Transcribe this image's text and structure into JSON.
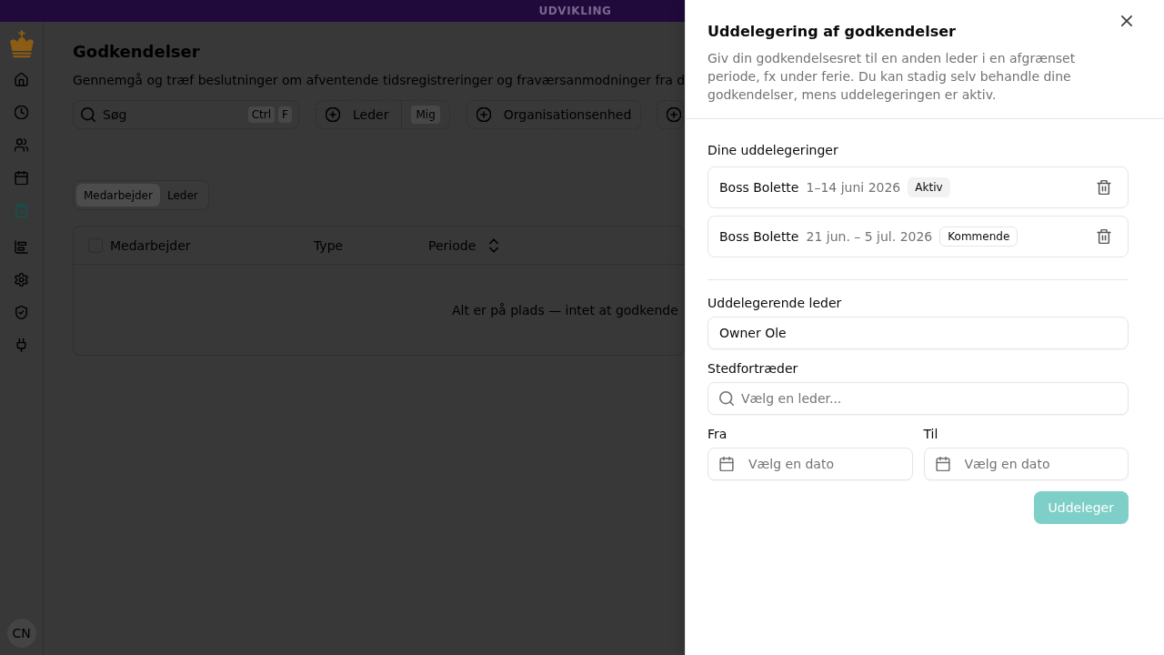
{
  "dev_banner": {
    "label": "UDVIKLING"
  },
  "sidebar": {
    "sections": [
      {
        "items": [
          {
            "selected": false
          },
          {
            "selected": false
          },
          {
            "selected": false
          },
          {
            "selected": false
          },
          {
            "selected": true
          }
        ]
      },
      {
        "items": [
          {
            "selected": false
          },
          {
            "selected": false
          },
          {
            "selected": false
          },
          {
            "selected": false
          }
        ]
      }
    ],
    "user": {
      "initials": "CN"
    }
  },
  "page": {
    "title": "Godkendelser",
    "description": "Gennemgå og træf beslutninger om afventende tidsregistreringer og fraværsanmodninger fra d"
  },
  "filters": {
    "search": {
      "placeholder": "Søg",
      "shortcut": [
        "Ctrl",
        "F"
      ]
    },
    "buttons": [
      {
        "kind": "filter",
        "label": "Leder",
        "value": "Mig"
      },
      {
        "kind": "filter",
        "label": "Organisationsenhed"
      },
      {
        "kind": "filter"
      }
    ]
  },
  "role_tabs": [
    {
      "label": "Medarbejder",
      "selected": true
    },
    {
      "label": "Leder",
      "selected": false
    }
  ],
  "table": {
    "select_all": {
      "checked": false
    },
    "columns": [
      {
        "label": "Medarbejder",
        "sortable": false
      },
      {
        "label": "Type",
        "sortable": false
      },
      {
        "label": "Periode",
        "sortable": true
      }
    ],
    "empty_message": "Alt er på plads — intet at godkende"
  },
  "drawer": {
    "title": "Uddelegering af godkendelser",
    "description": "Giv din godkendelsesret til en anden leder i en afgrænset periode, fx under ferie. Du kan stadig selv behandle dine godkendelser, mens uddelegeringen er aktiv.",
    "section_title": "Dine uddelegeringer",
    "delegations": [
      {
        "name": "Boss Bolette",
        "period": "1–14 juni 2026",
        "badge": {
          "label": "Aktiv",
          "kind": "filled"
        }
      },
      {
        "name": "Boss Bolette",
        "period": "21 jun. – 5 jul. 2026",
        "badge": {
          "label": "Kommende",
          "kind": "outline"
        }
      }
    ],
    "form": {
      "delegator": {
        "label": "Uddelegerende leder",
        "value": "Owner Ole"
      },
      "substitute": {
        "label": "Stedfortræder",
        "placeholder": "Vælg en leder..."
      },
      "from": {
        "label": "Fra",
        "placeholder": "Vælg en dato"
      },
      "to": {
        "label": "Til",
        "placeholder": "Vælg en dato"
      },
      "submit": {
        "label": "Uddeleger",
        "disabled": true
      }
    }
  }
}
